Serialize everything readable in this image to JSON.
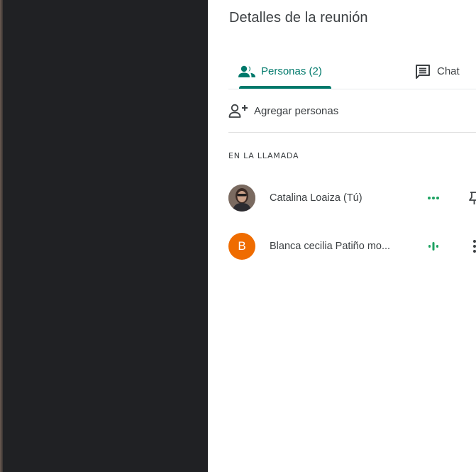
{
  "panel": {
    "title": "Detalles de la reunión"
  },
  "tabs": [
    {
      "label": "Personas (2)",
      "icon": "people-icon",
      "active": true
    },
    {
      "label": "Chat",
      "icon": "chat-icon",
      "active": false
    }
  ],
  "add_people": {
    "label": "Agregar personas",
    "icon": "add-person-icon"
  },
  "section": {
    "label": "EN LA LLAMADA"
  },
  "participants": [
    {
      "name": "Catalina Loaiza (Tú)",
      "avatar": "photo",
      "audio": "speaking-dots",
      "action": "pin-icon"
    },
    {
      "name": "Blanca cecilia Patiño mo...",
      "avatar_letter": "B",
      "avatar_color": "#ef6c00",
      "audio": "speaking-bars",
      "action": "more-vert-icon"
    }
  ],
  "colors": {
    "accent": "#00796b",
    "video_background": "#202124",
    "speaking_indicator": "#1ea362"
  }
}
